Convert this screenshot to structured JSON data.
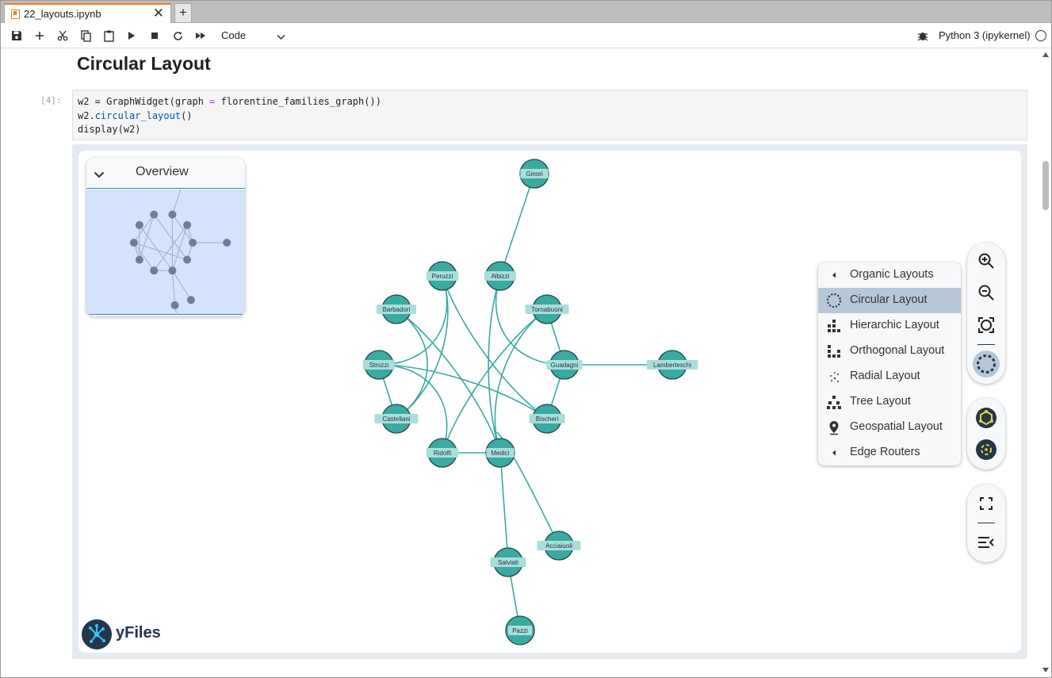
{
  "tab": {
    "title": "22_layouts.ipynb",
    "close": "✕",
    "new": "+"
  },
  "toolbar": {
    "cell_type": "Code",
    "kernel": "Python 3 (ipykernel)",
    "icons": [
      "save-icon",
      "plus-icon",
      "cut-icon",
      "copy-icon",
      "paste-icon",
      "run-icon",
      "stop-icon",
      "restart-icon",
      "fast-forward-icon"
    ]
  },
  "notebook": {
    "heading": "Circular Layout",
    "prompt": "[4]:",
    "code_line1_a": "w2 = GraphWidget(graph ",
    "code_line1_eq": "=",
    "code_line1_b": " florentine_families_graph())",
    "code_line2_a": "w2.",
    "code_line2_m": "circular_layout",
    "code_line2_b": "()",
    "code_line3": "display(w2)"
  },
  "overview": {
    "title": "Overview"
  },
  "layout_menu": {
    "items": [
      {
        "label": "Organic Layouts",
        "icon": "caret-left-icon"
      },
      {
        "label": "Circular Layout",
        "icon": "circular-layout-icon",
        "active": true
      },
      {
        "label": "Hierarchic Layout",
        "icon": "hierarchic-layout-icon"
      },
      {
        "label": "Orthogonal Layout",
        "icon": "orthogonal-layout-icon"
      },
      {
        "label": "Radial Layout",
        "icon": "radial-layout-icon"
      },
      {
        "label": "Tree Layout",
        "icon": "tree-layout-icon"
      },
      {
        "label": "Geospatial Layout",
        "icon": "map-pin-icon"
      },
      {
        "label": "Edge Routers",
        "icon": "caret-left-icon"
      }
    ]
  },
  "graph": {
    "node_color": "#3aaaa2",
    "edge_color": "#3aaaa2",
    "nodes": [
      "Ginori",
      "Peruzzi",
      "Albizzi",
      "Barbadori",
      "Tornabuoni",
      "Strozzi",
      "Guadagni",
      "Lamberteschi",
      "Castellani",
      "Bischeri",
      "Ridolfi",
      "Medici",
      "Acciaiuoli",
      "Salviati",
      "Pazzi"
    ],
    "edges": [
      [
        "Ginori",
        "Albizzi"
      ],
      [
        "Albizzi",
        "Medici"
      ],
      [
        "Albizzi",
        "Guadagni"
      ],
      [
        "Peruzzi",
        "Strozzi"
      ],
      [
        "Peruzzi",
        "Castellani"
      ],
      [
        "Peruzzi",
        "Bischeri"
      ],
      [
        "Barbadori",
        "Castellani"
      ],
      [
        "Barbadori",
        "Medici"
      ],
      [
        "Tornabuoni",
        "Guadagni"
      ],
      [
        "Tornabuoni",
        "Medici"
      ],
      [
        "Tornabuoni",
        "Ridolfi"
      ],
      [
        "Strozzi",
        "Castellani"
      ],
      [
        "Strozzi",
        "Ridolfi"
      ],
      [
        "Strozzi",
        "Bischeri"
      ],
      [
        "Guadagni",
        "Lamberteschi"
      ],
      [
        "Guadagni",
        "Bischeri"
      ],
      [
        "Ridolfi",
        "Medici"
      ],
      [
        "Medici",
        "Acciaiuoli"
      ],
      [
        "Medici",
        "Salviati"
      ],
      [
        "Salviati",
        "Pazzi"
      ]
    ]
  },
  "brand": {
    "name": "yFiles"
  }
}
